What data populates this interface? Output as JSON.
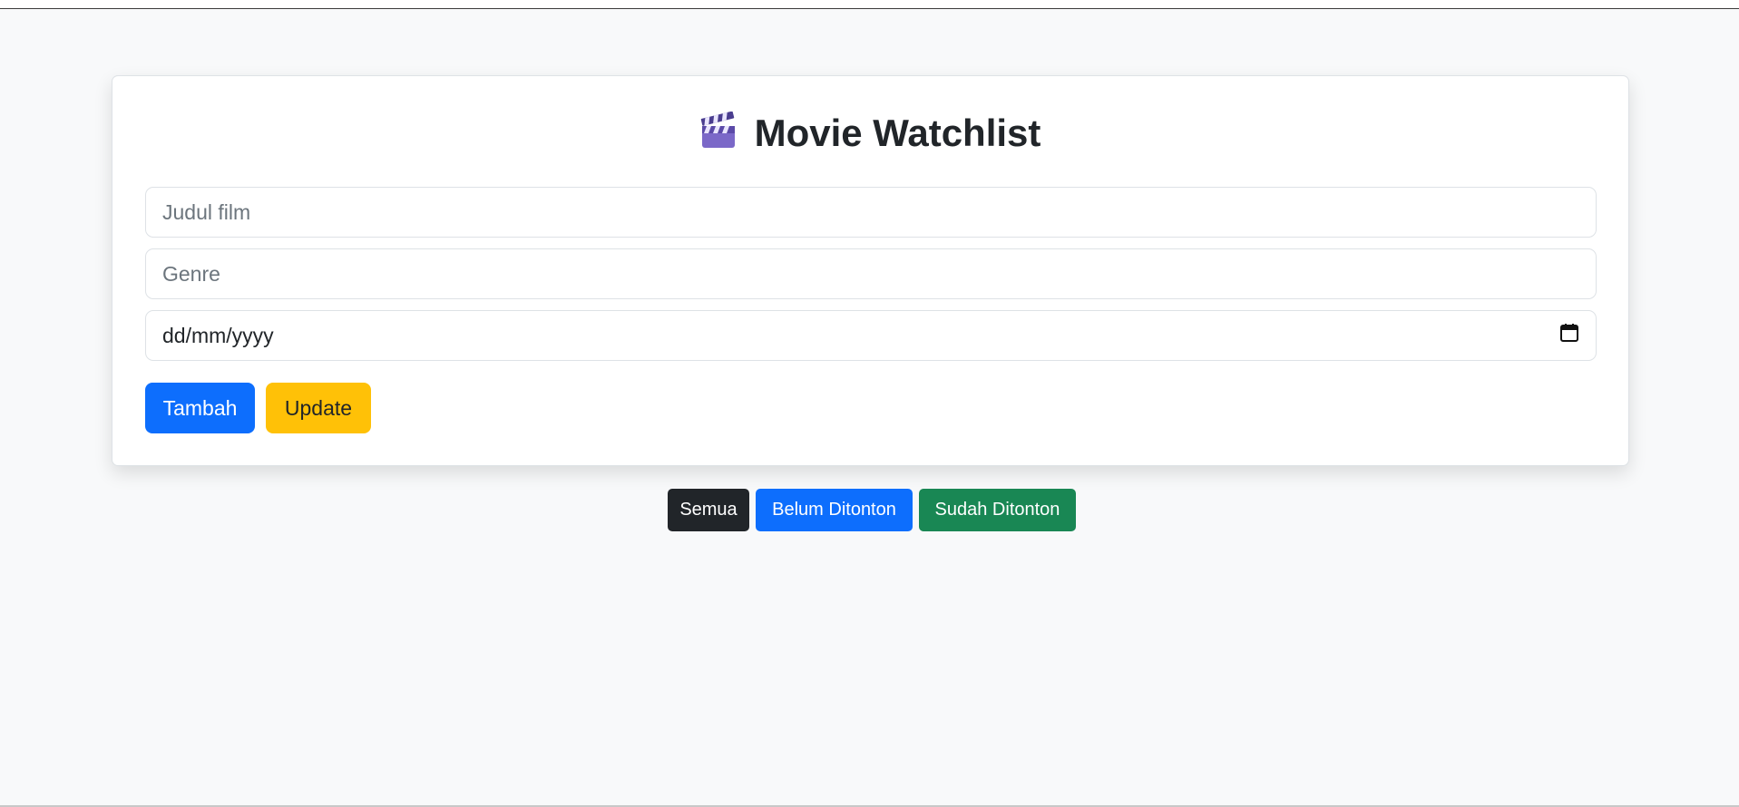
{
  "app": {
    "title": "Movie Watchlist",
    "title_icon": "clapper-board-icon"
  },
  "form": {
    "title_input": {
      "placeholder": "Judul film",
      "value": ""
    },
    "genre_input": {
      "placeholder": "Genre",
      "value": ""
    },
    "date_input": {
      "placeholder": "dd/mm/yyyy",
      "value": "",
      "icon": "calendar-icon"
    }
  },
  "actions": {
    "add_label": "Tambah",
    "update_label": "Update"
  },
  "filters": {
    "all_label": "Semua",
    "unwatched_label": "Belum Ditonton",
    "watched_label": "Sudah Ditonton"
  },
  "colors": {
    "primary": "#0d6efd",
    "warning": "#ffc107",
    "success": "#198754",
    "dark": "#212529",
    "background": "#f8f9fa"
  }
}
